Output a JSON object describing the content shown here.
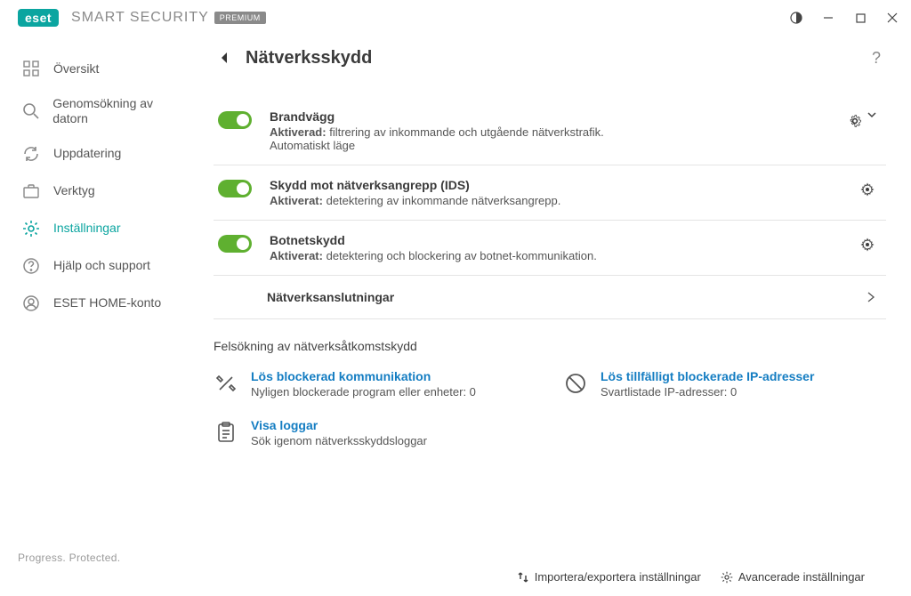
{
  "titlebar": {
    "brand": "eset",
    "product": "SMART SECURITY",
    "tier": "PREMIUM"
  },
  "sidebar": {
    "items": [
      {
        "label": "Översikt"
      },
      {
        "label": "Genomsökning av datorn"
      },
      {
        "label": "Uppdatering"
      },
      {
        "label": "Verktyg"
      },
      {
        "label": "Inställningar"
      },
      {
        "label": "Hjälp och support"
      },
      {
        "label": "ESET HOME-konto"
      }
    ],
    "footer": "Progress. Protected."
  },
  "page": {
    "title": "Nätverksskydd",
    "help": "?"
  },
  "modules": [
    {
      "title": "Brandvägg",
      "state": "Aktiverad:",
      "desc": "filtrering av inkommande och utgående nätverkstrafik.",
      "extra": "Automatiskt läge"
    },
    {
      "title": "Skydd mot nätverksangrepp (IDS)",
      "state": "Aktiverat:",
      "desc": "detektering av inkommande nätverksangrepp.",
      "extra": ""
    },
    {
      "title": "Botnetskydd",
      "state": "Aktiverat:",
      "desc": "detektering och blockering av botnet-kommunikation.",
      "extra": ""
    }
  ],
  "rowlink": {
    "title": "Nätverksanslutningar"
  },
  "troubleshoot": {
    "heading": "Felsökning av nätverksåtkomstskydd",
    "items": [
      {
        "title": "Lös blockerad kommunikation",
        "sub": "Nyligen blockerade program eller enheter: 0"
      },
      {
        "title": "Lös tillfälligt blockerade IP-adresser",
        "sub": "Svartlistade IP-adresser: 0"
      },
      {
        "title": "Visa loggar",
        "sub": "Sök igenom nätverksskyddsloggar"
      }
    ]
  },
  "bottom": {
    "import": "Importera/exportera inställningar",
    "advanced": "Avancerade inställningar"
  }
}
